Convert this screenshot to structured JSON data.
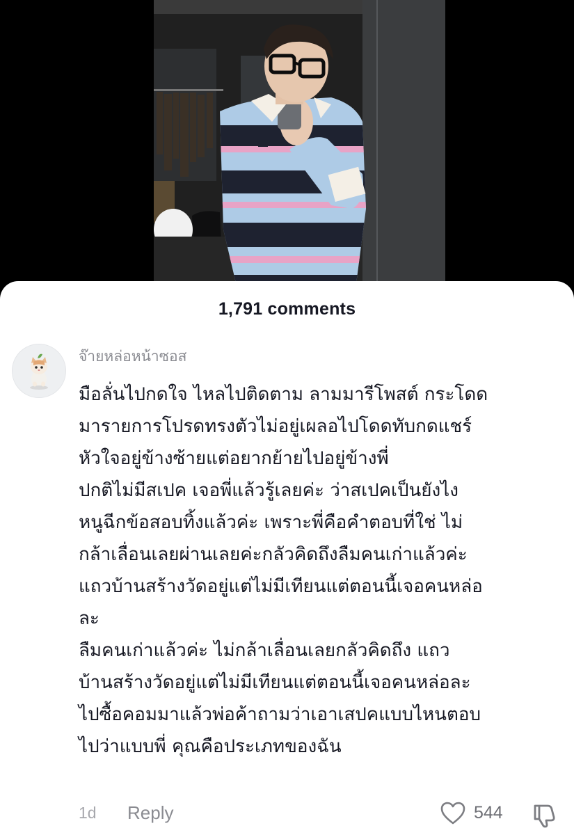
{
  "colors": {
    "sheet_bg": "#ffffff",
    "primary_text": "#161823",
    "secondary_text": "#8a8b91",
    "stripe_blue": "#aecbe6",
    "stripe_pink": "#e8a3c6",
    "stripe_navy": "#1e2230"
  },
  "photo": {
    "icon": "mirror-selfie-photo"
  },
  "comments": {
    "count_label": "1,791 comments"
  },
  "comment": {
    "avatar_icon": "cat-avatar-icon",
    "username": "จ๊ายหล่อหน้าซอส",
    "lines": [
      "มือลั่นไปกดใจ ไหลไปติดตาม ลามมารีโพสต์ กระโดด",
      "มารายการโปรดทรงตัวไม่อยู่เผลอไปโดดทับกดแชร์",
      "หัวใจอยู่ข้างซ้ายแต่อยากย้ายไปอยู่ข้างพี่",
      "ปกติไม่มีสเปค เจอพี่แล้วรู้เลยค่ะ ว่าสเปคเป็นยังไง",
      "หนูฉีกข้อสอบทิ้งแล้วค่ะ เพราะพี่คือคำตอบที่ใช่ ไม่",
      "กล้าเลื่อนเลยผ่านเลยค่ะกลัวคิดถึงลืมคนเก่าแล้วค่ะ",
      "แถวบ้านสร้างวัดอยู่แต่ไม่มีเทียนแต่ตอนนี้เจอคนหล่อ",
      "ละ",
      "ลืมคนเก่าแล้วค่ะ ไม่กล้าเลื่อนเลยกลัวคิดถึง แถว",
      "บ้านสร้างวัดอยู่แต่ไม่มีเทียนแต่ตอนนี้เจอคนหล่อละ",
      "ไปซื้อคอมมาแล้วพ่อค้าถามว่าเอาเสปคแบบไหนตอบ",
      "ไปว่าแบบพี่ คุณคือประเภทของฉัน"
    ],
    "time": "1d",
    "reply_label": "Reply",
    "like_icon": "heart-outline-icon",
    "like_count": "544",
    "dislike_icon": "thumbs-down-icon"
  }
}
